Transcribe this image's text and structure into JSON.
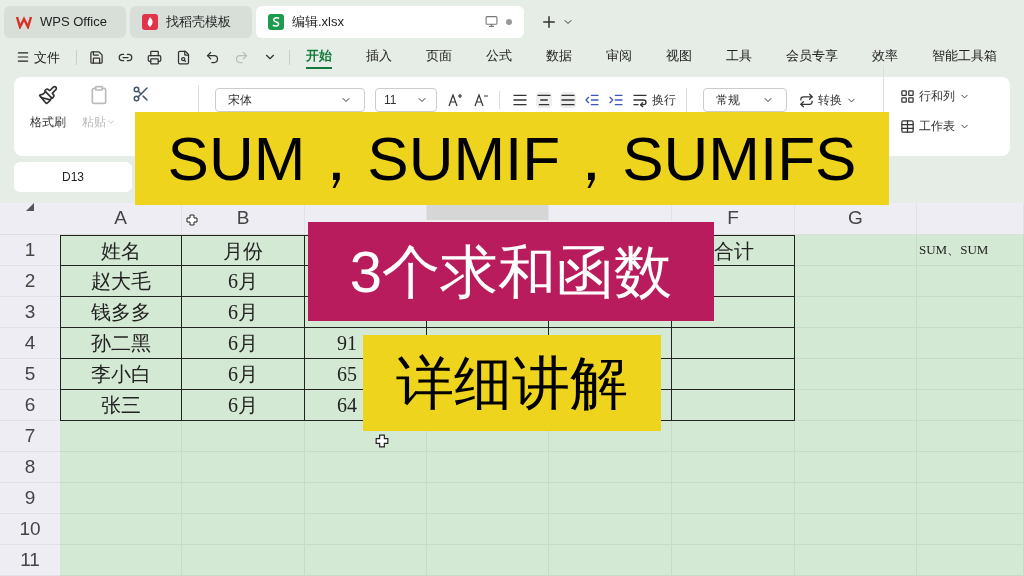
{
  "title_tabs": [
    {
      "kind": "wps",
      "label": "WPS Office",
      "selected": false
    },
    {
      "kind": "template",
      "label": "找稻壳模板",
      "selected": false
    },
    {
      "kind": "sheet",
      "label": "编辑.xlsx",
      "selected": true
    }
  ],
  "menu": {
    "file": "文件",
    "tabs": [
      {
        "label": "开始",
        "selected": true
      },
      {
        "label": "插入",
        "selected": false
      },
      {
        "label": "页面",
        "selected": false
      },
      {
        "label": "公式",
        "selected": false
      },
      {
        "label": "数据",
        "selected": false
      },
      {
        "label": "审阅",
        "selected": false
      },
      {
        "label": "视图",
        "selected": false
      },
      {
        "label": "工具",
        "selected": false
      },
      {
        "label": "会员专享",
        "selected": false
      },
      {
        "label": "效率",
        "selected": false
      },
      {
        "label": "智能工具箱",
        "selected": false
      }
    ]
  },
  "ribbon": {
    "format_painter": "格式刷",
    "paste": {
      "label": "粘贴",
      "disabled": true
    },
    "font": "宋体",
    "font_size": "11",
    "wrap": "换行",
    "number_format": "常规",
    "convert": "转换",
    "rows_cols": "行和列",
    "sheet": "工作表"
  },
  "name_box": "D13",
  "columns": [
    {
      "label": "A",
      "selected": false
    },
    {
      "label": "B",
      "selected": false
    },
    {
      "selected": false
    },
    {
      "selected": true
    },
    {
      "selected": false
    },
    {
      "label": "F",
      "selected": false
    },
    {
      "label": "G",
      "selected": false
    },
    {
      "selected": false
    }
  ],
  "rows": [
    {
      "number": "1",
      "bordered": true,
      "cells": [
        "姓名",
        "月份",
        null,
        null,
        null,
        "合计",
        null,
        "SUM、SUM"
      ]
    },
    {
      "number": "2",
      "bordered": true,
      "cells": [
        "赵大毛",
        "6月",
        null,
        null,
        null,
        null,
        null,
        null
      ]
    },
    {
      "number": "3",
      "bordered": true,
      "cells": [
        "钱多多",
        "6月",
        null,
        null,
        null,
        null,
        null,
        null
      ]
    },
    {
      "number": "4",
      "bordered": true,
      "cells": [
        "孙二黑",
        "6月",
        "91",
        null,
        null,
        null,
        null,
        null
      ]
    },
    {
      "number": "5",
      "bordered": true,
      "cells": [
        "李小白",
        "6月",
        "65",
        null,
        null,
        null,
        null,
        null
      ]
    },
    {
      "number": "6",
      "bordered": true,
      "cells": [
        "张三",
        "6月",
        "64",
        null,
        null,
        null,
        null,
        null
      ]
    },
    {
      "number": "7",
      "bordered": false,
      "cells": []
    },
    {
      "number": "8",
      "bordered": false,
      "cells": []
    },
    {
      "number": "9",
      "bordered": false,
      "cells": []
    },
    {
      "number": "10",
      "bordered": false,
      "cells": []
    },
    {
      "number": "11",
      "bordered": false,
      "cells": []
    }
  ],
  "overlays": [
    {
      "kind": "yellow",
      "text": "SUM，SUMIF，SUMIFS"
    },
    {
      "kind": "magenta",
      "text": "3个求和函数"
    },
    {
      "kind": "yellow-small",
      "text": "详细讲解"
    }
  ]
}
